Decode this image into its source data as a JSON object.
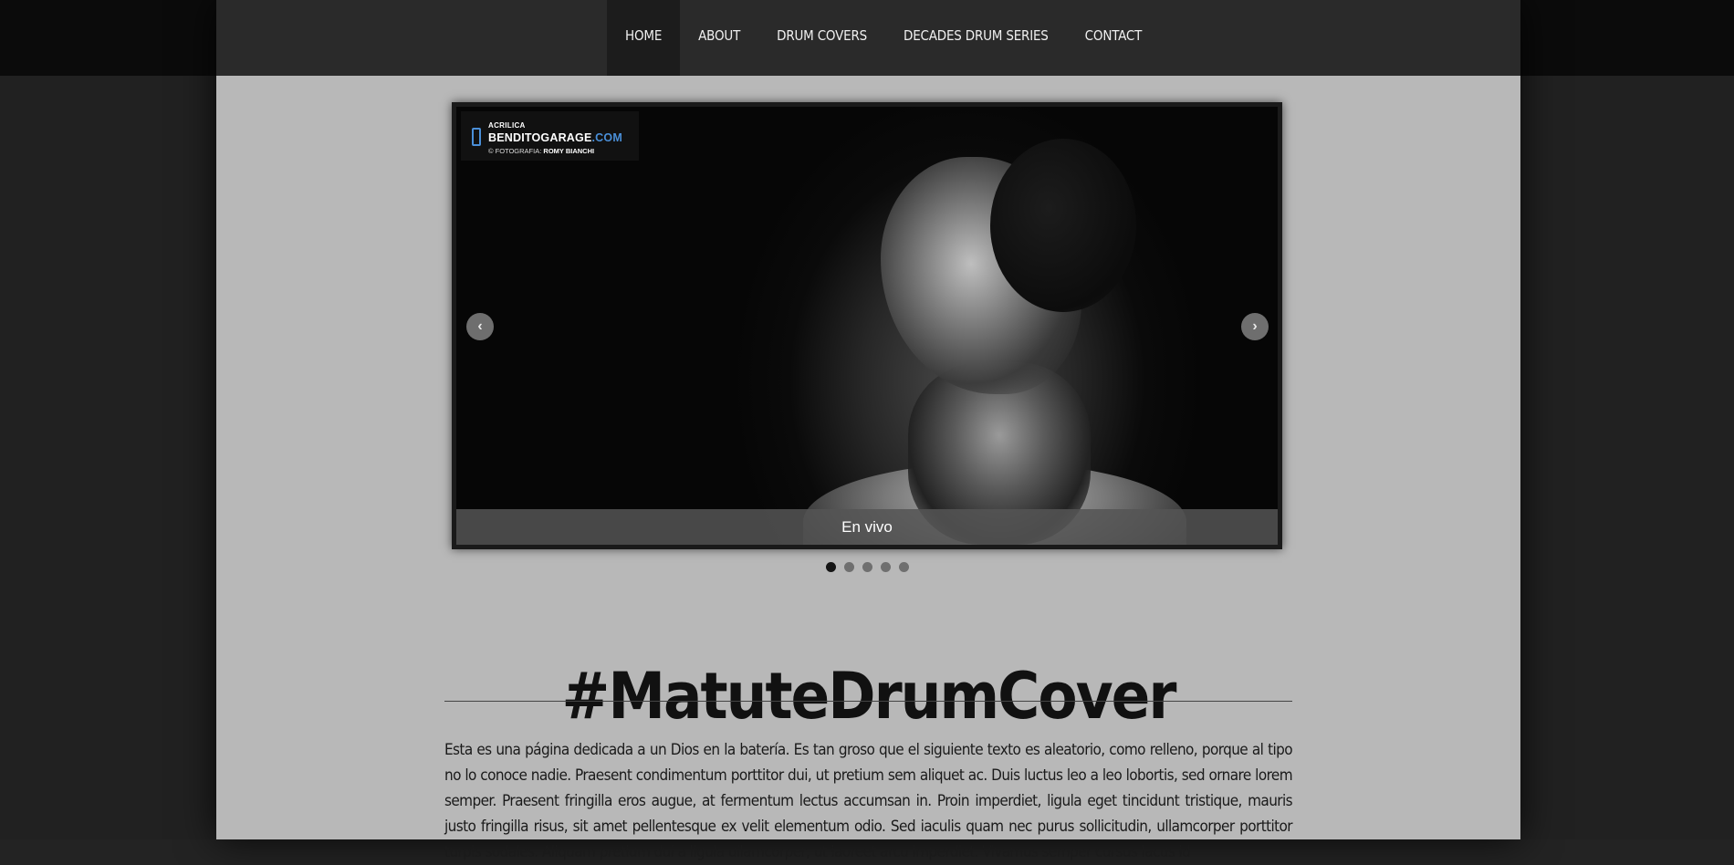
{
  "nav": {
    "items": [
      {
        "label": "HOME",
        "active": true
      },
      {
        "label": "ABOUT",
        "active": false
      },
      {
        "label": "DRUM COVERS",
        "active": false
      },
      {
        "label": "DECADES DRUM SERIES",
        "active": false
      },
      {
        "label": "CONTACT",
        "active": false
      }
    ]
  },
  "slider": {
    "logo": {
      "small": "ACRILICA",
      "main": "BENDITOGARAGE",
      "main_suffix": ".COM",
      "credit_prefix": "© FOTOGRAFIA:",
      "credit_name": "ROMY BIANCHI"
    },
    "prev_arrow": "‹",
    "next_arrow": "›",
    "caption": "En vivo",
    "dots": [
      {
        "active": true
      },
      {
        "active": false
      },
      {
        "active": false
      },
      {
        "active": false
      },
      {
        "active": false
      }
    ]
  },
  "main": {
    "title": "#MatuteDrumCover",
    "body": "Esta es una página dedicada a un Dios en la batería. Es tan groso que el siguiente texto es aleatorio, como relleno, porque al tipo no lo conoce nadie. Praesent condimentum porttitor dui, ut pretium sem aliquet ac. Duis luctus leo a leo lobortis, sed ornare lorem semper. Praesent fringilla eros augue, at fermentum lectus accumsan in. Proin imperdiet, ligula eget tincidunt tristique, mauris justo fringilla risus, sit amet pellentesque ex velit elementum odio. Sed iaculis quam nec purus sollicitudin, ullamcorper porttitor turpis sodales. Aliquam pretium dui a ligula ullamcorper, ut laoreet arcu imperdiet. Vivamus semper cursus lacus id"
  },
  "colors": {
    "page_bg": "#232323",
    "content_bg": "#b8b8b8",
    "nav_bg": "#2a2a2a",
    "nav_active_bg": "#1c1c1c",
    "logo_accent": "#4a8fd8"
  },
  "icons": {
    "prev": "chevron-left-icon",
    "next": "chevron-right-icon",
    "logo": "garage-logo-icon"
  }
}
